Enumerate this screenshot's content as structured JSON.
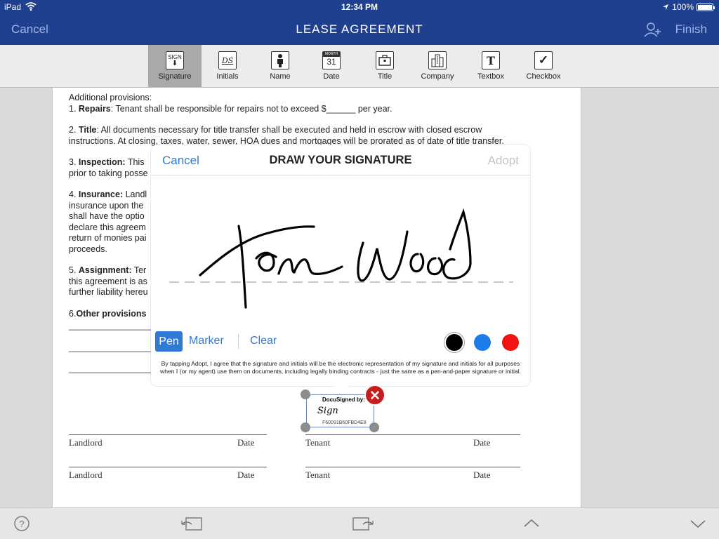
{
  "status": {
    "device": "iPad",
    "time": "12:34 PM",
    "battery": "100%"
  },
  "nav": {
    "cancel": "Cancel",
    "title": "LEASE AGREEMENT",
    "finish": "Finish"
  },
  "toolbar": [
    {
      "label": "Signature",
      "glyph": "SIGN"
    },
    {
      "label": "Initials",
      "glyph": "DS"
    },
    {
      "label": "Name",
      "glyph": ""
    },
    {
      "label": "Date",
      "glyph": "31"
    },
    {
      "label": "Title",
      "glyph": ""
    },
    {
      "label": "Company",
      "glyph": ""
    },
    {
      "label": "Textbox",
      "glyph": "T"
    },
    {
      "label": "Checkbox",
      "glyph": "✓"
    }
  ],
  "document": {
    "intro": "Additional provisions:",
    "p1_head": "1. ",
    "p1_bold": "Repairs",
    "p1_text": ": Tenant shall be responsible for repairs not to exceed $______ per year.",
    "p2_head": "2. ",
    "p2_bold": "Title",
    "p2_text": ": All documents necessary for title transfer shall be executed and held in escrow with closed escrow instructions. At closing, taxes, water, sewer, HOA dues and mortgages will be prorated as of date of title transfer.",
    "p3_head": "3. ",
    "p3_bold": "Inspection:",
    "p3_text": " This",
    "p3_line2": "prior to taking posse",
    "p4_head": "4. ",
    "p4_bold": "Insurance:",
    "p4_text": " Landl",
    "p4_lines": [
      "insurance upon the",
      "shall have the optio",
      "declare this agreem",
      "return of monies pai",
      "proceeds."
    ],
    "p5_head": "5. ",
    "p5_bold": "Assignment:",
    "p5_text": " Ter",
    "p5_lines": [
      "this agreement is as",
      "further liability hereu"
    ],
    "p6_head": "6.",
    "p6_bold": "Other provisions",
    "blank_lines": [
      "____________________",
      "____________________",
      "____________________"
    ],
    "sign_rows": [
      {
        "left": "Landlord",
        "left_date": "Date",
        "right": "Tenant",
        "right_date": "Date"
      },
      {
        "left": "Landlord",
        "left_date": "Date",
        "right": "Tenant",
        "right_date": "Date"
      }
    ]
  },
  "placed_tag": {
    "header": "DocuSigned by:",
    "sign": "Sign",
    "id": "F60091B60FBD4E8"
  },
  "signature_sheet": {
    "cancel": "Cancel",
    "title": "DRAW YOUR SIGNATURE",
    "adopt": "Adopt",
    "tools": {
      "pen": "Pen",
      "marker": "Marker",
      "clear": "Clear"
    },
    "colors": [
      "#000000",
      "#1e7bea",
      "#f01414"
    ],
    "selected_color": "#000000",
    "legal": "By tapping Adopt, I agree that the signature and initials will be the electronic representation of my signature and initials for all purposes when I (or my agent) use them on documents, including legally binding contracts - just the same as a pen-and-paper signature or initial."
  },
  "icons": {
    "help": "help-icon",
    "undo": "undo-icon",
    "redo": "redo-icon",
    "up": "chevron-up-icon",
    "down": "chevron-down-icon"
  }
}
